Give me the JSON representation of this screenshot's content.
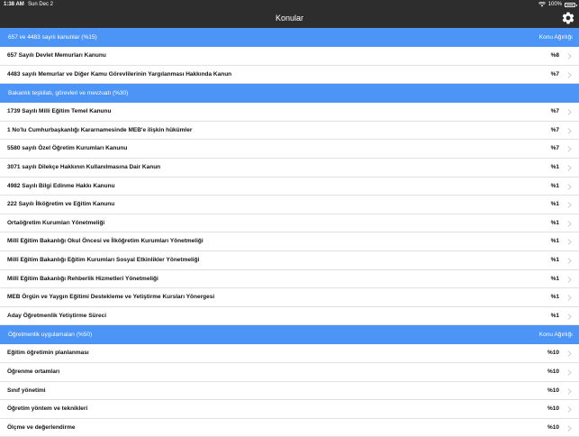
{
  "status": {
    "time": "1:38 AM",
    "date": "Sun Dec 2",
    "battery": "100%"
  },
  "nav": {
    "title": "Konular"
  },
  "sections": [
    {
      "title": "657 ve 4483 sayılı kanunlar (%15)",
      "right_label": "Konu Ağırlığı",
      "rows": [
        {
          "label": "657 Sayılı Devlet Memurları Kanunu",
          "pct": "%8"
        },
        {
          "label": "4483 sayılı Memurlar ve Diğer Kamu Görevlilerinin Yargılanması Hakkında Kanun",
          "pct": "%7"
        }
      ]
    },
    {
      "title": "Bakanlık teşkilatı, görevleri ve mevzuatı (%30)",
      "right_label": "",
      "rows": [
        {
          "label": "1739 Sayılı Milli Eğitim Temel Kanunu",
          "pct": "%7"
        },
        {
          "label": "1 No'lu Cumhurbaşkanlığı Kararnamesinde MEB'e ilişkin hükümler",
          "pct": "%7"
        },
        {
          "label": "5580 sayılı Özel Öğretim Kurumları Kanunu",
          "pct": "%7"
        },
        {
          "label": "3071 sayılı Dilekçe Hakkının Kullanılmasına Dair Kanun",
          "pct": "%1"
        },
        {
          "label": "4982 Sayılı Bilgi Edinme Hakkı Kanunu",
          "pct": "%1"
        },
        {
          "label": "222 Sayılı İlköğretim ve Eğitim Kanunu",
          "pct": "%1"
        },
        {
          "label": "Ortaöğretim Kurumları Yönetmeliği",
          "pct": "%1"
        },
        {
          "label": "Millî Eğitim Bakanlığı Okul Öncesi ve İlköğretim Kurumları Yönetmeliği",
          "pct": "%1"
        },
        {
          "label": "Millî Eğitim Bakanlığı Eğitim Kurumları Sosyal Etkinlikler Yönetmeliği",
          "pct": "%1"
        },
        {
          "label": "Millî Eğitim Bakanlığı Rehberlik Hizmetleri Yönetmeliği",
          "pct": "%1"
        },
        {
          "label": "MEB Örgün ve Yaygın Eğitimi Destekleme ve Yetiştirme Kursları Yönergesi",
          "pct": "%1"
        },
        {
          "label": "Aday Öğretmenlik Yetiştirme Süreci",
          "pct": "%1"
        }
      ]
    },
    {
      "title": "Öğretmenlik uygulamaları (%50)",
      "right_label": "Konu Ağırlığı",
      "rows": [
        {
          "label": "Eğitim öğretimin planlanması",
          "pct": "%10"
        },
        {
          "label": "Öğrenme ortamları",
          "pct": "%10"
        },
        {
          "label": "Sınıf yönetimi",
          "pct": "%10"
        },
        {
          "label": "Öğretim yöntem ve teknikleri",
          "pct": "%10"
        },
        {
          "label": "Ölçme ve değerlendirme",
          "pct": "%10"
        }
      ]
    }
  ],
  "icons": {
    "settings": "gear-icon",
    "row_disclosure": "chevron-right-icon",
    "wifi": "wifi-icon",
    "battery": "battery-icon"
  },
  "colors": {
    "bar": "#2d2d2d",
    "section_header": "#4c94f6",
    "divider": "#e1e1e1",
    "chevron": "#c7c7cc"
  }
}
